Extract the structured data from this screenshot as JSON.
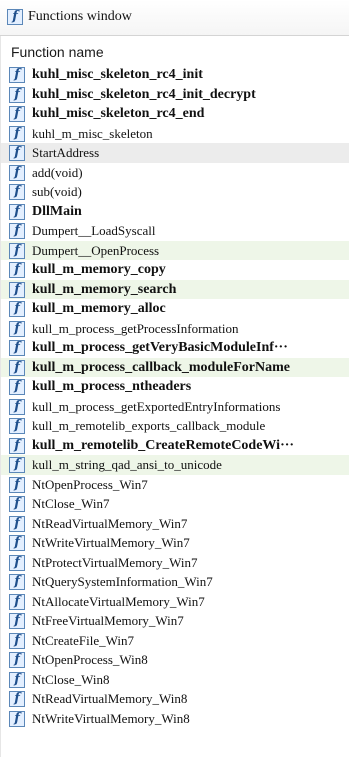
{
  "window": {
    "title": "Functions window",
    "title_icon": "function-icon"
  },
  "table": {
    "column_header": "Function name",
    "rows": [
      {
        "icon": "function-icon",
        "name": "kuhl_misc_skeleton_rc4_init",
        "bold": true,
        "highlight": "none"
      },
      {
        "icon": "function-icon",
        "name": "kuhl_misc_skeleton_rc4_init_decrypt",
        "bold": true,
        "highlight": "none"
      },
      {
        "icon": "function-icon",
        "name": "kuhl_misc_skeleton_rc4_end",
        "bold": true,
        "highlight": "none"
      },
      {
        "icon": "function-icon",
        "name": "kuhl_m_misc_skeleton",
        "bold": false,
        "highlight": "none"
      },
      {
        "icon": "function-icon",
        "name": "StartAddress",
        "bold": false,
        "highlight": "gray"
      },
      {
        "icon": "function-icon",
        "name": "add(void)",
        "bold": false,
        "highlight": "none"
      },
      {
        "icon": "function-icon",
        "name": "sub(void)",
        "bold": false,
        "highlight": "none"
      },
      {
        "icon": "function-icon",
        "name": "DllMain",
        "bold": true,
        "highlight": "none"
      },
      {
        "icon": "function-icon",
        "name": "Dumpert__LoadSyscall",
        "bold": false,
        "highlight": "none"
      },
      {
        "icon": "function-icon",
        "name": "Dumpert__OpenProcess",
        "bold": false,
        "highlight": "green"
      },
      {
        "icon": "function-icon",
        "name": "kull_m_memory_copy",
        "bold": true,
        "highlight": "none"
      },
      {
        "icon": "function-icon",
        "name": "kull_m_memory_search",
        "bold": true,
        "highlight": "green"
      },
      {
        "icon": "function-icon",
        "name": "kull_m_memory_alloc",
        "bold": true,
        "highlight": "none"
      },
      {
        "icon": "function-icon",
        "name": "kull_m_process_getProcessInformation",
        "bold": false,
        "highlight": "none"
      },
      {
        "icon": "function-icon",
        "name": "kull_m_process_getVeryBasicModuleInf···",
        "bold": true,
        "highlight": "none"
      },
      {
        "icon": "function-icon",
        "name": "kull_m_process_callback_moduleForName",
        "bold": true,
        "highlight": "green"
      },
      {
        "icon": "function-icon",
        "name": "kull_m_process_ntheaders",
        "bold": true,
        "highlight": "none"
      },
      {
        "icon": "function-icon",
        "name": "kull_m_process_getExportedEntryInformations",
        "bold": false,
        "highlight": "none"
      },
      {
        "icon": "function-icon",
        "name": "kull_m_remotelib_exports_callback_module",
        "bold": false,
        "highlight": "none"
      },
      {
        "icon": "function-icon",
        "name": "kull_m_remotelib_CreateRemoteCodeWi···",
        "bold": true,
        "highlight": "none"
      },
      {
        "icon": "function-icon",
        "name": "kull_m_string_qad_ansi_to_unicode",
        "bold": false,
        "highlight": "green"
      },
      {
        "icon": "function-icon",
        "name": "NtOpenProcess_Win7",
        "bold": false,
        "highlight": "none"
      },
      {
        "icon": "function-icon",
        "name": "NtClose_Win7",
        "bold": false,
        "highlight": "none"
      },
      {
        "icon": "function-icon",
        "name": "NtReadVirtualMemory_Win7",
        "bold": false,
        "highlight": "none"
      },
      {
        "icon": "function-icon",
        "name": "NtWriteVirtualMemory_Win7",
        "bold": false,
        "highlight": "none"
      },
      {
        "icon": "function-icon",
        "name": "NtProtectVirtualMemory_Win7",
        "bold": false,
        "highlight": "none"
      },
      {
        "icon": "function-icon",
        "name": "NtQuerySystemInformation_Win7",
        "bold": false,
        "highlight": "none"
      },
      {
        "icon": "function-icon",
        "name": "NtAllocateVirtualMemory_Win7",
        "bold": false,
        "highlight": "none"
      },
      {
        "icon": "function-icon",
        "name": "NtFreeVirtualMemory_Win7",
        "bold": false,
        "highlight": "none"
      },
      {
        "icon": "function-icon",
        "name": "NtCreateFile_Win7",
        "bold": false,
        "highlight": "none"
      },
      {
        "icon": "function-icon",
        "name": "NtOpenProcess_Win8",
        "bold": false,
        "highlight": "none"
      },
      {
        "icon": "function-icon",
        "name": "NtClose_Win8",
        "bold": false,
        "highlight": "none"
      },
      {
        "icon": "function-icon",
        "name": "NtReadVirtualMemory_Win8",
        "bold": false,
        "highlight": "none"
      },
      {
        "icon": "function-icon",
        "name": "NtWriteVirtualMemory_Win8",
        "bold": false,
        "highlight": "none"
      }
    ]
  },
  "colors": {
    "icon_border": "#5b87b8",
    "icon_fill": "#e3efff",
    "icon_glyph": "#1f4f8c",
    "row_highlight_gray": "#ececec",
    "row_highlight_green": "#eef6e8"
  }
}
